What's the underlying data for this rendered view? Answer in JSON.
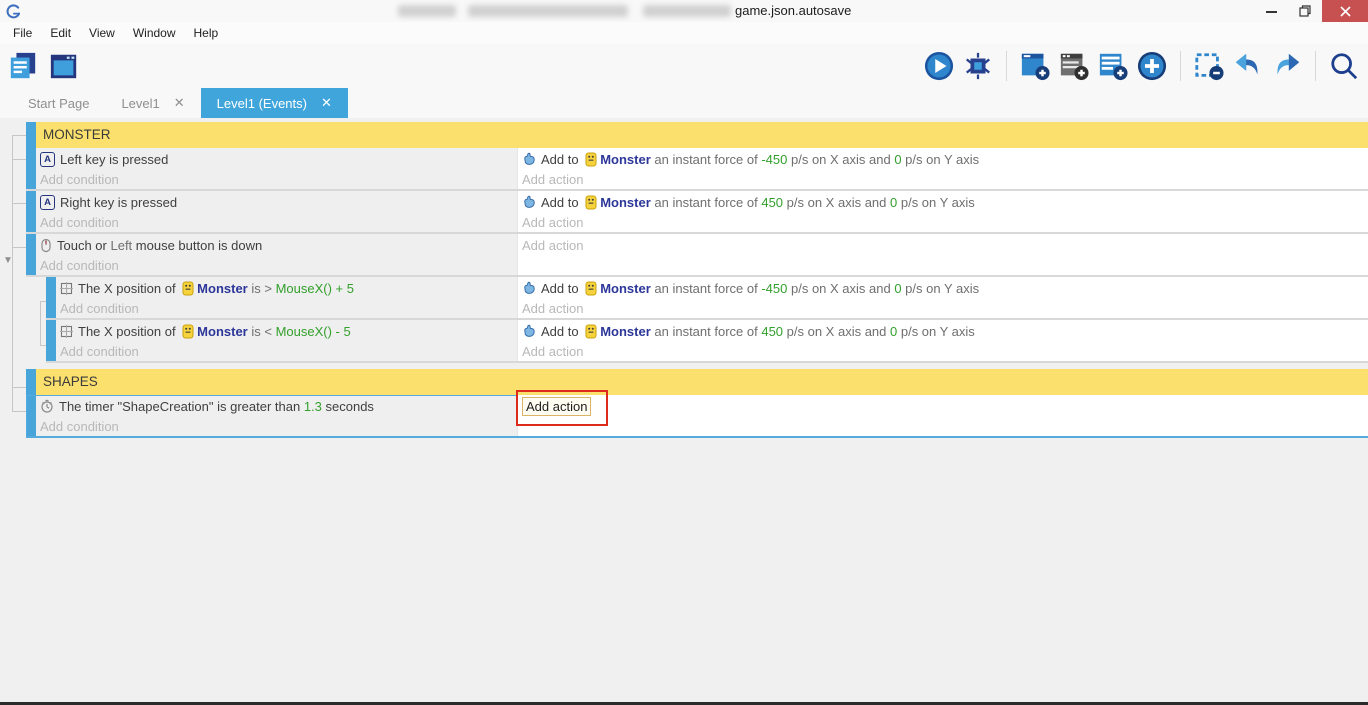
{
  "window": {
    "title_visible_suffix": "game.json.autosave",
    "controls": {
      "minimize": "–",
      "restore": "restore",
      "close": "✕"
    }
  },
  "menu_bar": {
    "items": [
      "File",
      "Edit",
      "View",
      "Window",
      "Help"
    ]
  },
  "toolbar": {
    "left_icons": [
      "project-manager-icon",
      "scene-window-icon"
    ],
    "right_icons": [
      "play-icon",
      "debugger-icon",
      "sep",
      "add-event-icon",
      "add-comment-icon",
      "add-subevent-icon",
      "add-more-icon",
      "sep",
      "remove-selection-icon",
      "undo-icon",
      "redo-icon",
      "sep",
      "search-icon"
    ]
  },
  "tabs": [
    {
      "label": "Start Page",
      "active": false,
      "closable": false
    },
    {
      "label": "Level1",
      "active": false,
      "closable": true
    },
    {
      "label": "Level1 (Events)",
      "active": true,
      "closable": true
    }
  ],
  "events_sheet": {
    "condition_placeholder": "Add condition",
    "action_placeholder": "Add action",
    "rows": [
      {
        "type": "group",
        "label": "MONSTER"
      },
      {
        "type": "event",
        "indent": 0,
        "conditions": [
          {
            "icon": "keyboard-key-icon",
            "segments": [
              {
                "t": "Left ",
                "c": "t"
              },
              {
                "t": "key is pressed",
                "c": "t"
              }
            ]
          }
        ],
        "actions": [
          {
            "icon": "force-hand-icon",
            "segments": [
              {
                "t": "Add to ",
                "c": "t"
              },
              {
                "icon": "monster-sprite-icon"
              },
              {
                "t": "Monster",
                "c": "o"
              },
              {
                "t": " an instant force of ",
                "c": "t2"
              },
              {
                "t": "-450",
                "c": "v"
              },
              {
                "t": " p/s on X axis and ",
                "c": "t2"
              },
              {
                "t": "0",
                "c": "v"
              },
              {
                "t": " p/s on Y axis",
                "c": "t2"
              }
            ]
          }
        ]
      },
      {
        "type": "event",
        "indent": 0,
        "conditions": [
          {
            "icon": "keyboard-key-icon",
            "segments": [
              {
                "t": "Right ",
                "c": "t"
              },
              {
                "t": "key is pressed",
                "c": "t"
              }
            ]
          }
        ],
        "actions": [
          {
            "icon": "force-hand-icon",
            "segments": [
              {
                "t": "Add to ",
                "c": "t"
              },
              {
                "icon": "monster-sprite-icon"
              },
              {
                "t": "Monster",
                "c": "o"
              },
              {
                "t": " an instant force of ",
                "c": "t2"
              },
              {
                "t": "450",
                "c": "v"
              },
              {
                "t": " p/s on X axis and ",
                "c": "t2"
              },
              {
                "t": "0",
                "c": "v"
              },
              {
                "t": " p/s on Y axis",
                "c": "t2"
              }
            ]
          }
        ]
      },
      {
        "type": "event",
        "indent": 0,
        "has_children": true,
        "conditions": [
          {
            "icon": "mouse-icon",
            "segments": [
              {
                "t": "Touch or ",
                "c": "t"
              },
              {
                "t": "Left",
                "c": "t2"
              },
              {
                "t": " mouse button is down",
                "c": "t"
              }
            ]
          }
        ],
        "actions": []
      },
      {
        "type": "event",
        "indent": 1,
        "conditions": [
          {
            "icon": "position-icon",
            "segments": [
              {
                "t": "The X position of ",
                "c": "t"
              },
              {
                "icon": "monster-sprite-icon"
              },
              {
                "t": "Monster",
                "c": "o"
              },
              {
                "t": " is ",
                "c": "t2"
              },
              {
                "t": "> ",
                "c": "t2"
              },
              {
                "t": "MouseX() + 5",
                "c": "v"
              }
            ]
          }
        ],
        "actions": [
          {
            "icon": "force-hand-icon",
            "segments": [
              {
                "t": "Add to ",
                "c": "t"
              },
              {
                "icon": "monster-sprite-icon"
              },
              {
                "t": "Monster",
                "c": "o"
              },
              {
                "t": " an instant force of ",
                "c": "t2"
              },
              {
                "t": "-450",
                "c": "v"
              },
              {
                "t": " p/s on X axis and ",
                "c": "t2"
              },
              {
                "t": "0",
                "c": "v"
              },
              {
                "t": " p/s on Y axis",
                "c": "t2"
              }
            ]
          }
        ]
      },
      {
        "type": "event",
        "indent": 1,
        "conditions": [
          {
            "icon": "position-icon",
            "segments": [
              {
                "t": "The X position of ",
                "c": "t"
              },
              {
                "icon": "monster-sprite-icon"
              },
              {
                "t": "Monster",
                "c": "o"
              },
              {
                "t": " is ",
                "c": "t2"
              },
              {
                "t": "< ",
                "c": "t2"
              },
              {
                "t": "MouseX() - 5",
                "c": "v"
              }
            ]
          }
        ],
        "actions": [
          {
            "icon": "force-hand-icon",
            "segments": [
              {
                "t": "Add to ",
                "c": "t"
              },
              {
                "icon": "monster-sprite-icon"
              },
              {
                "t": "Monster",
                "c": "o"
              },
              {
                "t": " an instant force of ",
                "c": "t2"
              },
              {
                "t": "450",
                "c": "v"
              },
              {
                "t": " p/s on X axis and ",
                "c": "t2"
              },
              {
                "t": "0",
                "c": "v"
              },
              {
                "t": " p/s on Y axis",
                "c": "t2"
              }
            ]
          }
        ]
      },
      {
        "type": "group",
        "label": "SHAPES",
        "gap_before": true
      },
      {
        "type": "event",
        "indent": 0,
        "selected": true,
        "focused_action_placeholder": true,
        "annotated": true,
        "conditions": [
          {
            "icon": "timer-icon",
            "segments": [
              {
                "t": "The timer ",
                "c": "t"
              },
              {
                "t": "\"ShapeCreation\"",
                "c": "t"
              },
              {
                "t": " is greater than ",
                "c": "t"
              },
              {
                "t": "1.3",
                "c": "v"
              },
              {
                "t": " seconds",
                "c": "t"
              }
            ]
          }
        ],
        "actions": []
      }
    ]
  },
  "annotation": {
    "shape": "rectangle",
    "color": "#dc2b1c"
  },
  "colors": {
    "accent_blue": "#40a5da",
    "group_yellow": "#fbe06e",
    "object_navy": "#2c3799",
    "value_green": "#33a02c",
    "close_red": "#c75050"
  }
}
